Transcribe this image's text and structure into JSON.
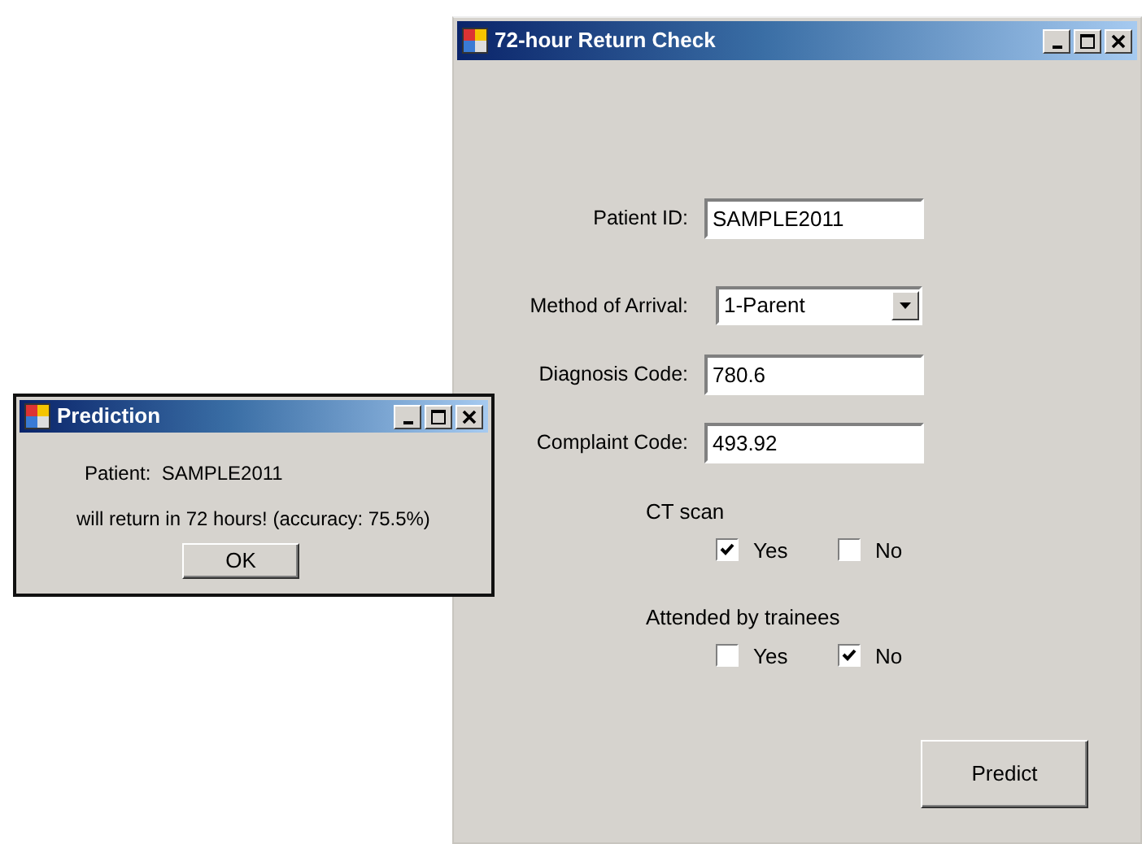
{
  "main_window": {
    "title": "72-hour Return Check",
    "fields": [
      {
        "kind": "text",
        "label": "Patient ID:",
        "value": "SAMPLE2011"
      },
      {
        "kind": "dropdown",
        "label": "Method of Arrival:",
        "value": "1-Parent"
      },
      {
        "kind": "text",
        "label": "Diagnosis Code:",
        "value": "780.6"
      },
      {
        "kind": "text",
        "label": "Complaint Code:",
        "value": "493.92"
      }
    ],
    "check_groups": [
      {
        "label": "CT scan",
        "options": [
          {
            "label": "Yes",
            "checked": true
          },
          {
            "label": "No",
            "checked": false
          }
        ]
      },
      {
        "label": "Attended by trainees",
        "options": [
          {
            "label": "Yes",
            "checked": false
          },
          {
            "label": "No",
            "checked": true
          }
        ]
      }
    ],
    "button": "Predict"
  },
  "dialog": {
    "title": "Prediction",
    "lines": [
      "Patient:  SAMPLE2011",
      "will return in 72 hours! (accuracy: 75.5%)"
    ],
    "button": "OK"
  }
}
